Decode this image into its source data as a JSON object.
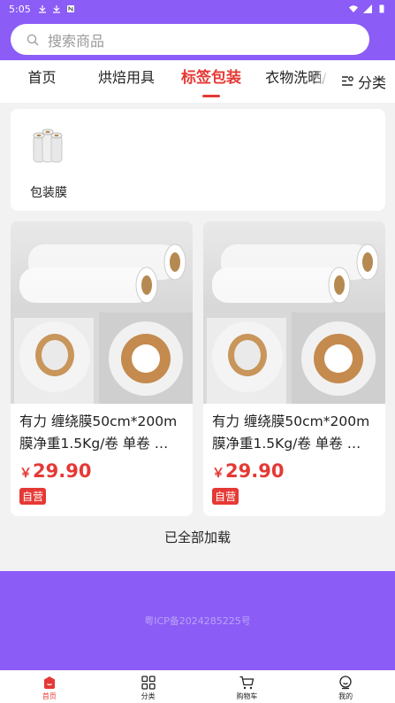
{
  "status_bar": {
    "time": "5:05"
  },
  "search": {
    "placeholder": "搜索商品"
  },
  "tabs": [
    {
      "label": "首页",
      "active": false
    },
    {
      "label": "烘焙用具",
      "active": false
    },
    {
      "label": "标签包装",
      "active": true
    },
    {
      "label": "衣物洗晒/",
      "active": false
    }
  ],
  "category_button": {
    "label": "分类",
    "icon": "category-list-icon"
  },
  "subcategories": [
    {
      "label": "包装膜",
      "icon": "wrap-film-rolls-image"
    }
  ],
  "products": [
    {
      "title": "有力 缠绕膜50cm*200m膜净重1.5Kg/卷 单卷 …",
      "currency": "￥",
      "price": "29.90",
      "badge": "自营"
    },
    {
      "title": "有力 缠绕膜50cm*200m膜净重1.5Kg/卷 单卷 …",
      "currency": "￥",
      "price": "29.90",
      "badge": "自营"
    }
  ],
  "list_end_text": "已全部加载",
  "footer": {
    "icp": "粤ICP备2024285225号"
  },
  "bottom_nav": [
    {
      "label": "首页",
      "icon": "home-icon",
      "active": true
    },
    {
      "label": "分类",
      "icon": "grid-icon",
      "active": false
    },
    {
      "label": "购物车",
      "icon": "cart-icon",
      "active": false
    },
    {
      "label": "我的",
      "icon": "profile-icon",
      "active": false
    }
  ],
  "colors": {
    "brand_purple": "#8b5cf6",
    "accent_red": "#e53935"
  }
}
